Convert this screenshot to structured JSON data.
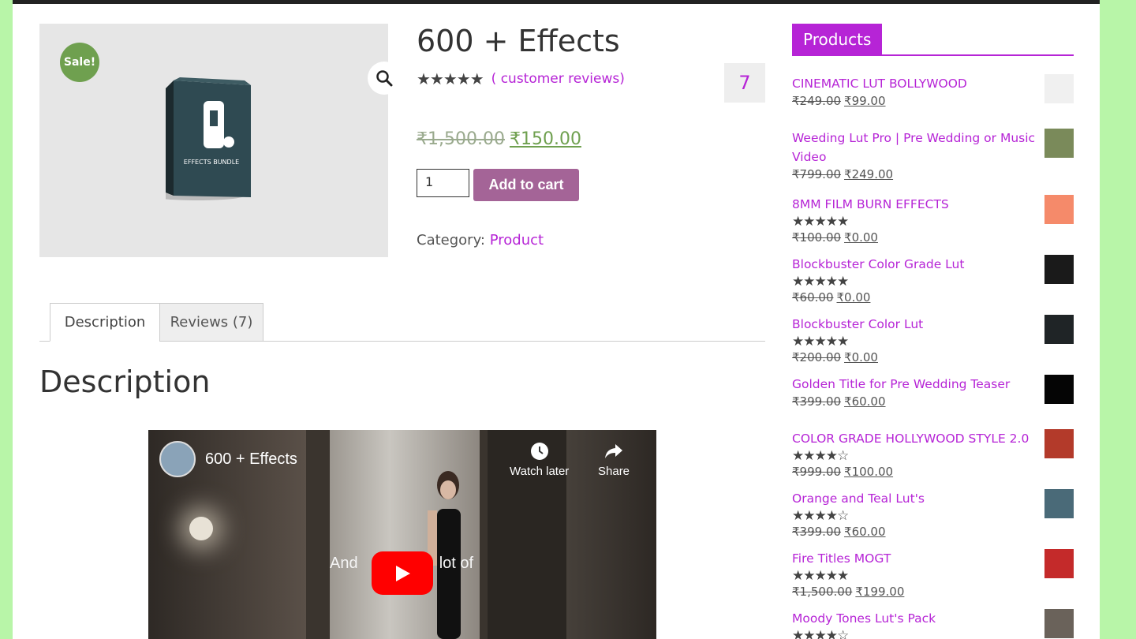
{
  "product": {
    "sale_badge": "Sale!",
    "title": "600 + Effects",
    "stars": "★★★★★",
    "reviews_link": "( customer reviews)",
    "review_count": "7",
    "price_old": "₹1,500.00",
    "price_new": "₹150.00",
    "qty": "1",
    "add_to_cart": "Add to cart",
    "category_label": "Category:",
    "category_value": "Product",
    "box_label": "EFFECTS BUNDLE"
  },
  "tabs": [
    {
      "label": "Description"
    },
    {
      "label": "Reviews (7)"
    }
  ],
  "description_heading": "Description",
  "video": {
    "title": "600 + Effects",
    "watch_later": "Watch later",
    "share": "Share",
    "caption_left": "And",
    "caption_right": "lot of"
  },
  "sidebar": {
    "title": "Products",
    "products": [
      {
        "name": "CINEMATIC LUT BOLLYWOOD",
        "stars": "",
        "old": "₹249.00",
        "new": "₹99.00",
        "thumb": "#f0f0f0"
      },
      {
        "name": "Weeding Lut Pro | Pre Wedding or Music Video",
        "stars": "",
        "old": "₹799.00",
        "new": "₹249.00",
        "thumb": "#7a8a5a"
      },
      {
        "name": "8MM FILM BURN EFFECTS",
        "stars": "★★★★★",
        "old": "₹100.00",
        "new": "₹0.00",
        "thumb": "#f58a6a"
      },
      {
        "name": "Blockbuster Color Grade Lut",
        "stars": "★★★★★",
        "old": "₹60.00",
        "new": "₹0.00",
        "thumb": "#1a1a1a"
      },
      {
        "name": "Blockbuster Color Lut",
        "stars": "★★★★★",
        "old": "₹200.00",
        "new": "₹0.00",
        "thumb": "#1f2426"
      },
      {
        "name": "Golden Title for Pre Wedding Teaser",
        "stars": "",
        "old": "₹399.00",
        "new": "₹60.00",
        "thumb": "#050505"
      },
      {
        "name": "COLOR GRADE HOLLYWOOD STYLE 2.0",
        "stars": "★★★★☆",
        "old": "₹999.00",
        "new": "₹100.00",
        "thumb": "#b33a2a"
      },
      {
        "name": "Orange and Teal Lut's",
        "stars": "★★★★☆",
        "old": "₹399.00",
        "new": "₹60.00",
        "thumb": "#4a6a78"
      },
      {
        "name": "Fire Titles MOGT",
        "stars": "★★★★★",
        "old": "₹1,500.00",
        "new": "₹199.00",
        "thumb": "#c42a2a"
      },
      {
        "name": "Moody Tones Lut's Pack",
        "stars": "★★★★☆",
        "old": "",
        "new": "",
        "thumb": "#6a625a"
      }
    ]
  }
}
